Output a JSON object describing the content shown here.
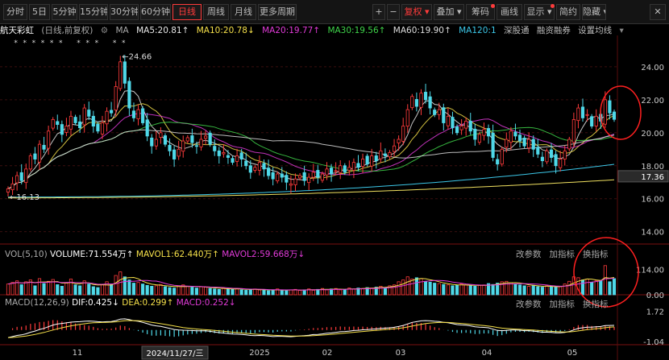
{
  "toolbar": {
    "periods": [
      "分时",
      "5日",
      "5分钟",
      "15分钟",
      "30分钟",
      "60分钟",
      "日线",
      "周线",
      "月线",
      "更多周期"
    ],
    "active_period": "日线",
    "tools": [
      "+",
      "−",
      "复权",
      "叠加",
      "筹码",
      "画线",
      "显示",
      "简约",
      "隐藏"
    ]
  },
  "legend": {
    "name": "航天彩虹",
    "adjust": "(日线,前复权)",
    "ma_label": "MA",
    "ma5": "MA5:20.81↑",
    "ma10": "MA10:20.78↓",
    "ma20": "MA20:19.77↑",
    "ma30": "MA30:19.56↑",
    "ma60": "MA60:19.90↑",
    "ma120": "MA120:1",
    "links": [
      "深股通",
      "融资融券",
      "设置均线"
    ]
  },
  "vol_legend": {
    "title": "VOL(5,10)",
    "volume": "VOLUME:71.554万↑",
    "mavol1": "MAVOL1:62.440万↑",
    "mavol2": "MAVOL2:59.668万↓"
  },
  "macd_legend": {
    "title": "MACD(12,26,9)",
    "dif": "DIF:0.425↓",
    "dea": "DEA:0.299↑",
    "macd": "MACD:0.252↓"
  },
  "panel_links": [
    "改参数",
    "加指标",
    "换指标"
  ],
  "annotations": {
    "high": "24.66",
    "low": "16.13",
    "current_price": "17.36",
    "cursor_date": "2024/11/27/三"
  },
  "colors": {
    "up": "#ff3b3b",
    "down": "#4fd8e8",
    "ma5": "#e8e8e8",
    "ma10": "#f5e04a",
    "ma20": "#e23bd9",
    "ma30": "#3fd44a",
    "ma60": "#dddddd",
    "ma120": "#3cc7e8",
    "ma250": "#f0e060",
    "circle": "#ff2020"
  },
  "chart_data": {
    "type": "candlestick",
    "price_axis": {
      "ticks": [
        14.0,
        16.0,
        18.0,
        20.0,
        22.0,
        24.0
      ],
      "ylim": [
        13.3,
        25.9
      ]
    },
    "volume_axis": {
      "ticks": [
        "0.00",
        "114.00"
      ],
      "ylim": [
        0,
        158
      ]
    },
    "macd_axis": {
      "ticks": [
        "-1.04",
        "0.34",
        "1.72"
      ],
      "ylim": [
        -1.2,
        1.9
      ]
    },
    "x_labels": [
      "11",
      "2025",
      "02",
      "03",
      "04",
      "05"
    ],
    "close": [
      16.6,
      16.9,
      17.4,
      17.1,
      17.8,
      18.6,
      18.4,
      19.3,
      19.0,
      20.1,
      20.8,
      20.5,
      19.9,
      20.4,
      21.0,
      20.6,
      20.3,
      21.5,
      21.0,
      20.4,
      20.1,
      20.6,
      21.3,
      21.2,
      22.8,
      24.3,
      23.0,
      21.5,
      20.9,
      21.4,
      20.6,
      19.8,
      19.2,
      19.6,
      20.0,
      19.3,
      18.9,
      18.4,
      19.0,
      19.5,
      19.7,
      19.4,
      19.2,
      19.6,
      19.8,
      19.3,
      18.9,
      18.6,
      18.8,
      18.5,
      18.2,
      18.6,
      18.4,
      18.0,
      17.6,
      17.9,
      18.2,
      17.8,
      17.4,
      17.2,
      17.5,
      17.3,
      17.0,
      16.9,
      17.2,
      17.4,
      17.1,
      17.3,
      17.6,
      17.3,
      17.5,
      17.8,
      17.5,
      17.7,
      18.0,
      17.6,
      17.9,
      18.2,
      17.9,
      18.4,
      18.1,
      18.6,
      18.3,
      18.9,
      18.6,
      18.8,
      19.2,
      19.6,
      20.4,
      21.4,
      22.2,
      21.6,
      22.4,
      22.0,
      21.5,
      21.1,
      21.4,
      20.6,
      21.0,
      20.3,
      20.0,
      20.4,
      20.7,
      20.1,
      19.6,
      19.9,
      20.2,
      19.8,
      18.5,
      18.1,
      19.0,
      19.6,
      20.1,
      19.8,
      19.5,
      19.2,
      19.6,
      19.0,
      18.7,
      18.3,
      18.9,
      18.5,
      18.0,
      18.4,
      18.9,
      19.6,
      20.8,
      21.5,
      20.9,
      21.1,
      20.4,
      21.0,
      20.7,
      22.0,
      21.2,
      20.81
    ],
    "volume": [
      48,
      55,
      62,
      45,
      58,
      66,
      40,
      72,
      50,
      60,
      68,
      45,
      38,
      52,
      70,
      44,
      40,
      62,
      48,
      36,
      32,
      44,
      58,
      46,
      86,
      102,
      80,
      66,
      52,
      55,
      48,
      42,
      38,
      40,
      46,
      36,
      32,
      30,
      40,
      44,
      38,
      34,
      30,
      36,
      34,
      28,
      26,
      24,
      30,
      26,
      24,
      28,
      22,
      20,
      24,
      26,
      22,
      20,
      18,
      22,
      26,
      20,
      18,
      22,
      24,
      20,
      22,
      26,
      20,
      24,
      28,
      22,
      26,
      28,
      22,
      24,
      30,
      26,
      30,
      28,
      32,
      30,
      34,
      38,
      32,
      40,
      44,
      58,
      66,
      80,
      70,
      76,
      72,
      60,
      56,
      52,
      50,
      46,
      44,
      40,
      42,
      48,
      44,
      40,
      38,
      42,
      44,
      50,
      46,
      52,
      58,
      60,
      54,
      46,
      44,
      40,
      38,
      42,
      36,
      34,
      40,
      36,
      34,
      38,
      48,
      60,
      80,
      76,
      66,
      70,
      56,
      62,
      64,
      130,
      58,
      72
    ],
    "dif": [
      -0.7,
      -0.6,
      -0.5,
      -0.45,
      -0.35,
      -0.2,
      -0.1,
      0.05,
      0.15,
      0.3,
      0.45,
      0.55,
      0.6,
      0.65,
      0.72,
      0.75,
      0.76,
      0.8,
      0.82,
      0.8,
      0.76,
      0.74,
      0.76,
      0.78,
      0.86,
      1.0,
      1.02,
      0.95,
      0.85,
      0.8,
      0.7,
      0.58,
      0.45,
      0.38,
      0.33,
      0.24,
      0.15,
      0.05,
      0.0,
      -0.02,
      -0.03,
      -0.05,
      -0.08,
      -0.08,
      -0.08,
      -0.12,
      -0.18,
      -0.24,
      -0.28,
      -0.32,
      -0.37,
      -0.38,
      -0.4,
      -0.45,
      -0.5,
      -0.52,
      -0.5,
      -0.52,
      -0.56,
      -0.6,
      -0.58,
      -0.58,
      -0.6,
      -0.62,
      -0.58,
      -0.54,
      -0.52,
      -0.48,
      -0.42,
      -0.4,
      -0.36,
      -0.3,
      -0.27,
      -0.22,
      -0.16,
      -0.14,
      -0.1,
      -0.05,
      -0.03,
      0.02,
      0.04,
      0.08,
      0.1,
      0.15,
      0.17,
      0.2,
      0.25,
      0.32,
      0.42,
      0.56,
      0.7,
      0.76,
      0.84,
      0.86,
      0.84,
      0.8,
      0.78,
      0.7,
      0.66,
      0.58,
      0.5,
      0.46,
      0.44,
      0.38,
      0.3,
      0.26,
      0.24,
      0.2,
      0.08,
      -0.04,
      -0.06,
      -0.04,
      0.0,
      0.0,
      -0.02,
      -0.06,
      -0.06,
      -0.1,
      -0.15,
      -0.2,
      -0.2,
      -0.22,
      -0.26,
      -0.26,
      -0.22,
      -0.14,
      0.0,
      0.14,
      0.2,
      0.26,
      0.26,
      0.3,
      0.32,
      0.4,
      0.42,
      0.425
    ]
  }
}
